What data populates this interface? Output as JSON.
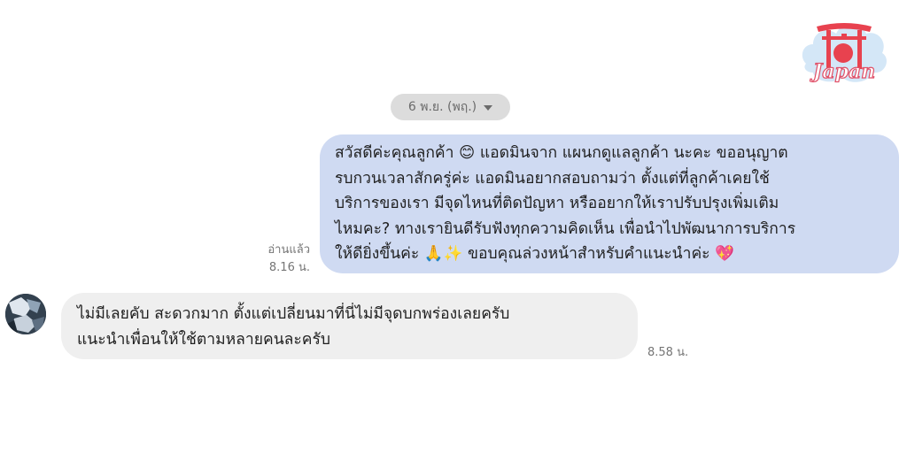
{
  "logo": {
    "text": "Japan",
    "icon": "japan-torii-logo"
  },
  "date_divider": {
    "label": "6 พ.ย. (พฤ.)",
    "icon": "caret-down-icon"
  },
  "messages": [
    {
      "direction": "outgoing",
      "lines": [
        "สวัสดีค่ะคุณลูกค้า 😊 แอดมินจาก แผนกดูแลลูกค้า นะคะ ขออนุญาต",
        "รบกวนเวลาสักครู่ค่ะ แอดมินอยากสอบถามว่า ตั้งแต่ที่ลูกค้าเคยใช้",
        "บริการของเรา มีจุดไหนที่ติดปัญหา หรืออยากให้เราปรับปรุงเพิ่มเติม",
        "ไหมคะ? ทางเรายินดีรับฟังทุกความคิดเห็น เพื่อนำไปพัฒนาการบริการ",
        "ให้ดียิ่งขึ้นค่ะ 🙏✨ ขอบคุณล่วงหน้าสำหรับคำแนะนำค่ะ 💖"
      ],
      "read_status": "อ่านแล้ว",
      "time": "8.16 น.",
      "bubble_color": "#cfdaf2"
    },
    {
      "direction": "incoming",
      "lines": [
        "ไม่มีเลยคับ สะดวกมาก ตั้งแต่เปลี่ยนมาที่นี่ไม่มีจุดบกพร่องเลยครับ",
        "แนะนำเพื่อนให้ใช้ตามหลายคนละครับ"
      ],
      "time": "8.58 น.",
      "avatar": "user-avatar",
      "bubble_color": "#efefef"
    }
  ]
}
